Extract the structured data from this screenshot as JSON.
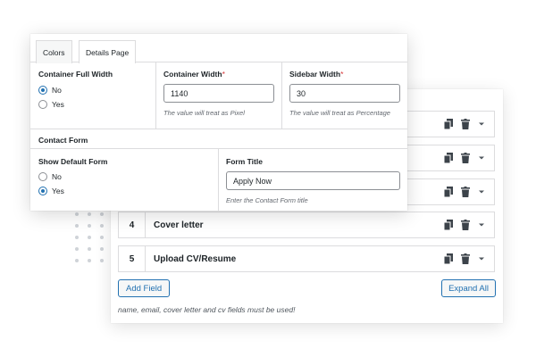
{
  "tabs": [
    {
      "label": "Colors",
      "active": false
    },
    {
      "label": "Details Page",
      "active": true
    }
  ],
  "container_full_width": {
    "title": "Container Full Width",
    "options": [
      {
        "label": "No",
        "checked": true
      },
      {
        "label": "Yes",
        "checked": false
      }
    ]
  },
  "container_width": {
    "title": "Container Width",
    "required_mark": "*",
    "value": "1140",
    "hint": "The value will treat as Pixel"
  },
  "sidebar_width": {
    "title": "Sidebar Width",
    "required_mark": "*",
    "value": "30",
    "hint": "The value will treat as Percentage"
  },
  "contact_form": {
    "section_title": "Contact Form",
    "show_default_form": {
      "title": "Show Default Form",
      "options": [
        {
          "label": "No",
          "checked": false
        },
        {
          "label": "Yes",
          "checked": true
        }
      ]
    },
    "form_title": {
      "title": "Form Title",
      "value": "Apply Now",
      "hint": "Enter the Contact Form title"
    }
  },
  "fields": [
    {
      "num": "",
      "label": ""
    },
    {
      "num": "",
      "label": ""
    },
    {
      "num": "",
      "label": ""
    },
    {
      "num": "4",
      "label": "Cover letter"
    },
    {
      "num": "5",
      "label": "Upload CV/Resume"
    }
  ],
  "buttons": {
    "add_field": "Add Field",
    "expand_all": "Expand All"
  },
  "note": "name, email, cover letter and cv fields must be used!",
  "icons": {
    "copy": "copy-icon",
    "trash": "trash-icon",
    "toggle": "caret-down-icon"
  },
  "colors": {
    "accent": "#2271b1",
    "required": "#d63638",
    "border": "#dcdcde"
  }
}
